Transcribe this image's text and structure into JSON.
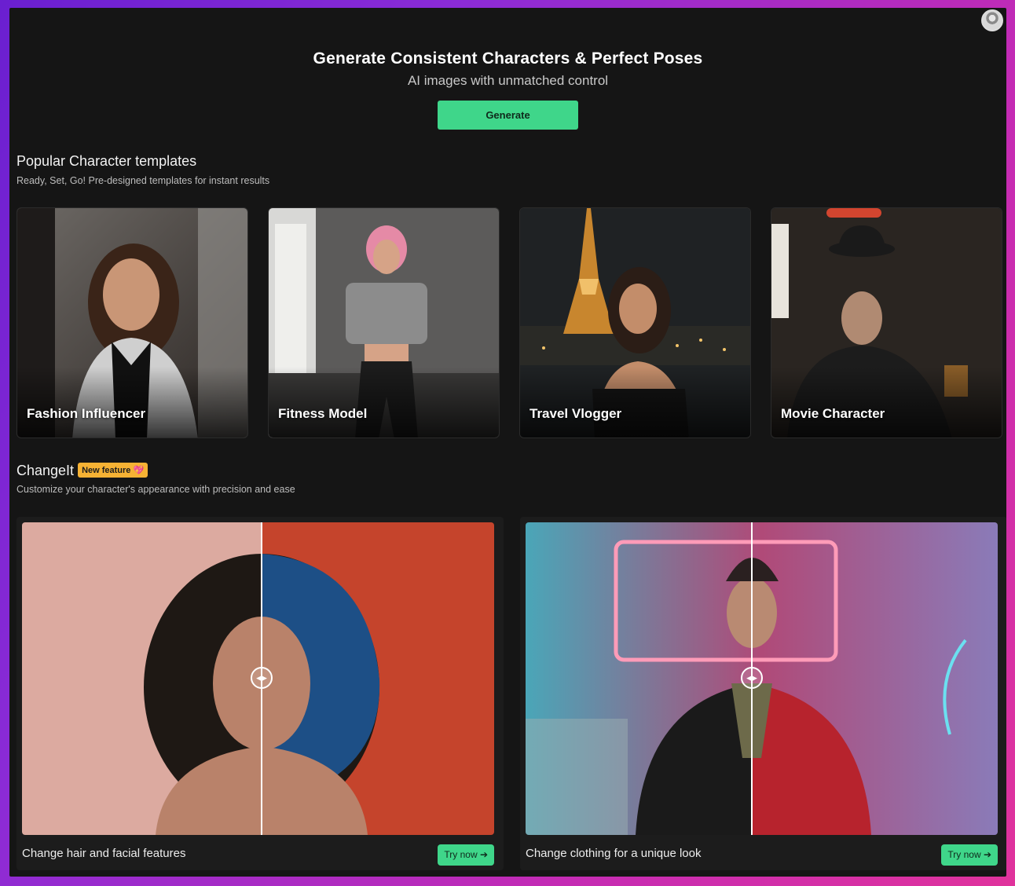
{
  "header": {
    "title": "Generate Consistent Characters & Perfect Poses",
    "subtitle": "AI images with unmatched control",
    "generate_label": "Generate"
  },
  "templates": {
    "title": "Popular Character templates",
    "subtitle": "Ready, Set, Go! Pre-designed templates for instant results",
    "items": [
      {
        "label": "Fashion Influencer"
      },
      {
        "label": "Fitness Model"
      },
      {
        "label": "Travel Vlogger"
      },
      {
        "label": "Movie Character"
      }
    ]
  },
  "changeit": {
    "title": "ChangeIt",
    "badge": "New feature 💖",
    "subtitle": "Customize your character's appearance with precision and ease",
    "panels": [
      {
        "caption": "Change hair and facial features",
        "try_label": "Try now ➔"
      },
      {
        "caption": "Change clothing for a unique look",
        "try_label": "Try now ➔"
      }
    ]
  },
  "colors": {
    "accent": "#3fd68a",
    "badge": "#f6b234",
    "background": "#151515"
  },
  "icons": {
    "avatar": "user-avatar",
    "compare_handle": "left-right-arrows-icon",
    "arrow": "arrow-right-icon"
  }
}
